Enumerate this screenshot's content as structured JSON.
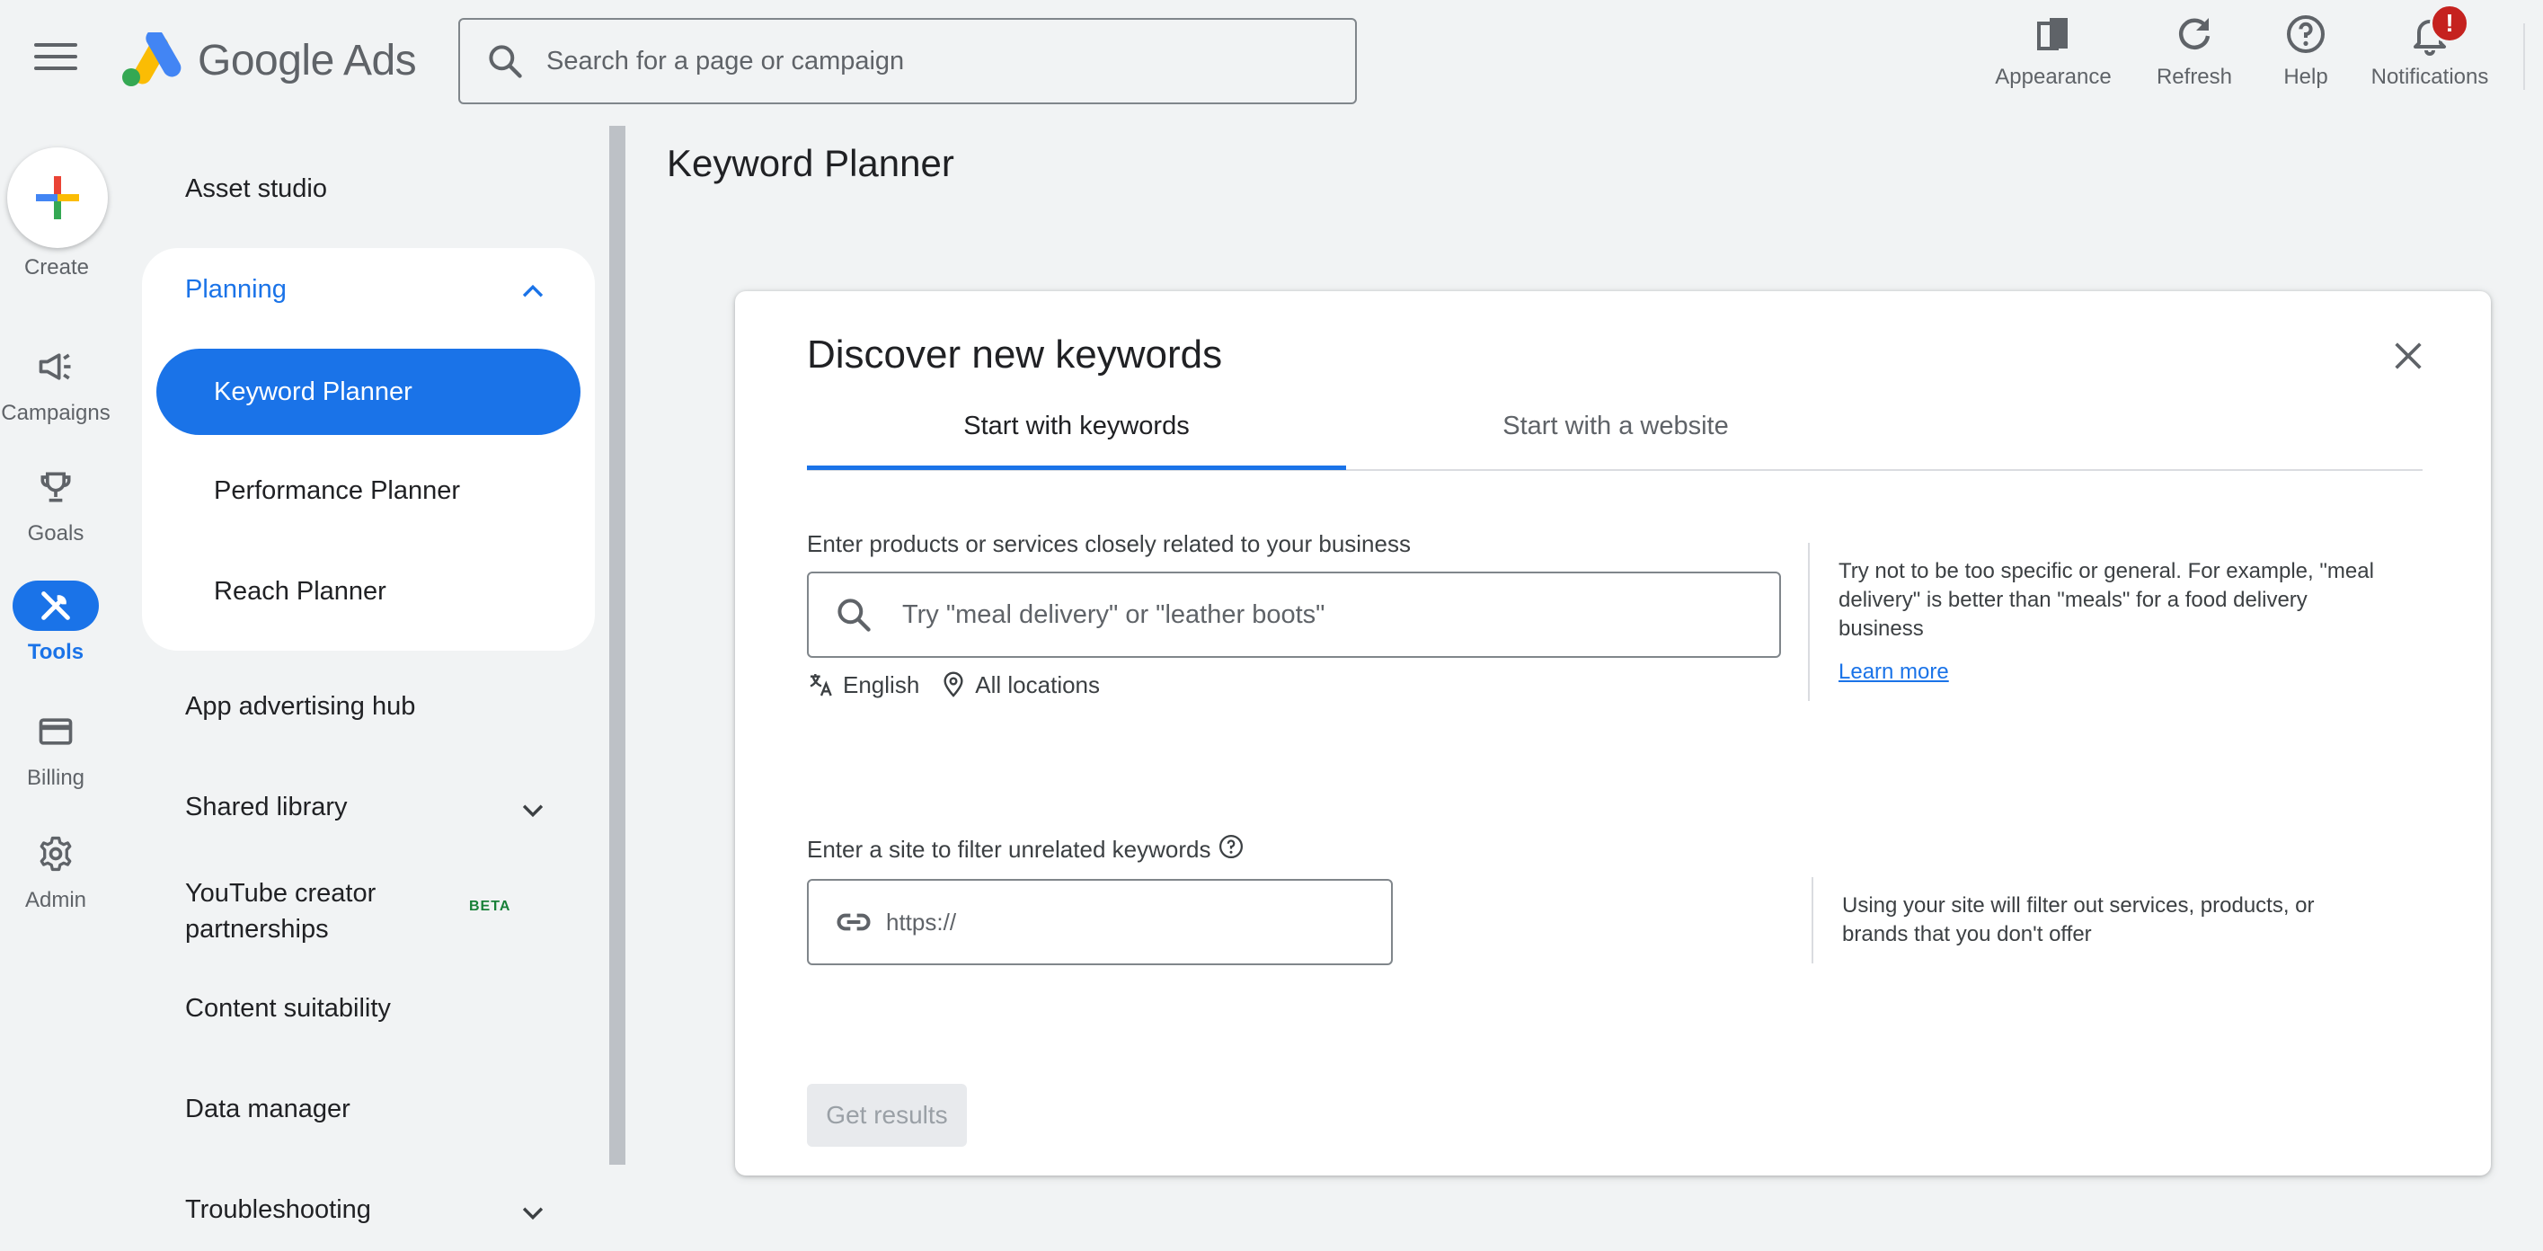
{
  "header": {
    "brand": "Google Ads",
    "search_placeholder": "Search for a page or campaign",
    "actions": {
      "appearance": "Appearance",
      "refresh": "Refresh",
      "help": "Help",
      "notifications": "Notifications",
      "notification_badge": "!"
    }
  },
  "rail": {
    "create": "Create",
    "campaigns": "Campaigns",
    "goals": "Goals",
    "tools": "Tools",
    "billing": "Billing",
    "admin": "Admin"
  },
  "nav": {
    "asset_studio": "Asset studio",
    "planning": "Planning",
    "keyword_planner": "Keyword Planner",
    "performance_planner": "Performance Planner",
    "reach_planner": "Reach Planner",
    "app_advertising_hub": "App advertising hub",
    "shared_library": "Shared library",
    "youtube_creator_line1": "YouTube creator",
    "youtube_creator_line2": "partnerships",
    "beta": "BETA",
    "content_suitability": "Content suitability",
    "data_manager": "Data manager",
    "troubleshooting": "Troubleshooting"
  },
  "main": {
    "page_title": "Keyword Planner",
    "dialog": {
      "title": "Discover new keywords",
      "tabs": [
        {
          "label": "Start with keywords",
          "active": true
        },
        {
          "label": "Start with a website",
          "active": false
        }
      ],
      "keywords_label": "Enter products or services closely related to your business",
      "keywords_placeholder": "Try \"meal delivery\" or \"leather boots\"",
      "language": "English",
      "location": "All locations",
      "keywords_help": "Try not to be too specific or general. For example, \"meal delivery\" is better than \"meals\" for a food delivery business",
      "learn_more": "Learn more",
      "site_label": "Enter a site to filter unrelated keywords",
      "site_placeholder": "https://",
      "site_help": "Using your site will filter out services, products, or brands that you don't offer",
      "get_results": "Get results"
    }
  },
  "colors": {
    "accent": "#1a73e8",
    "background": "#f1f3f4",
    "badge": "#c5221f",
    "beta": "#188038"
  },
  "icons": [
    "menu-icon",
    "google-ads-logo",
    "search-icon",
    "appearance-icon",
    "refresh-icon",
    "help-icon",
    "bell-icon",
    "plus-icon",
    "megaphone-icon",
    "trophy-icon",
    "tools-icon",
    "credit-card-icon",
    "gear-icon",
    "chevron-up-icon",
    "chevron-down-icon",
    "close-icon",
    "translate-icon",
    "location-pin-icon",
    "question-circle-icon",
    "link-icon"
  ]
}
